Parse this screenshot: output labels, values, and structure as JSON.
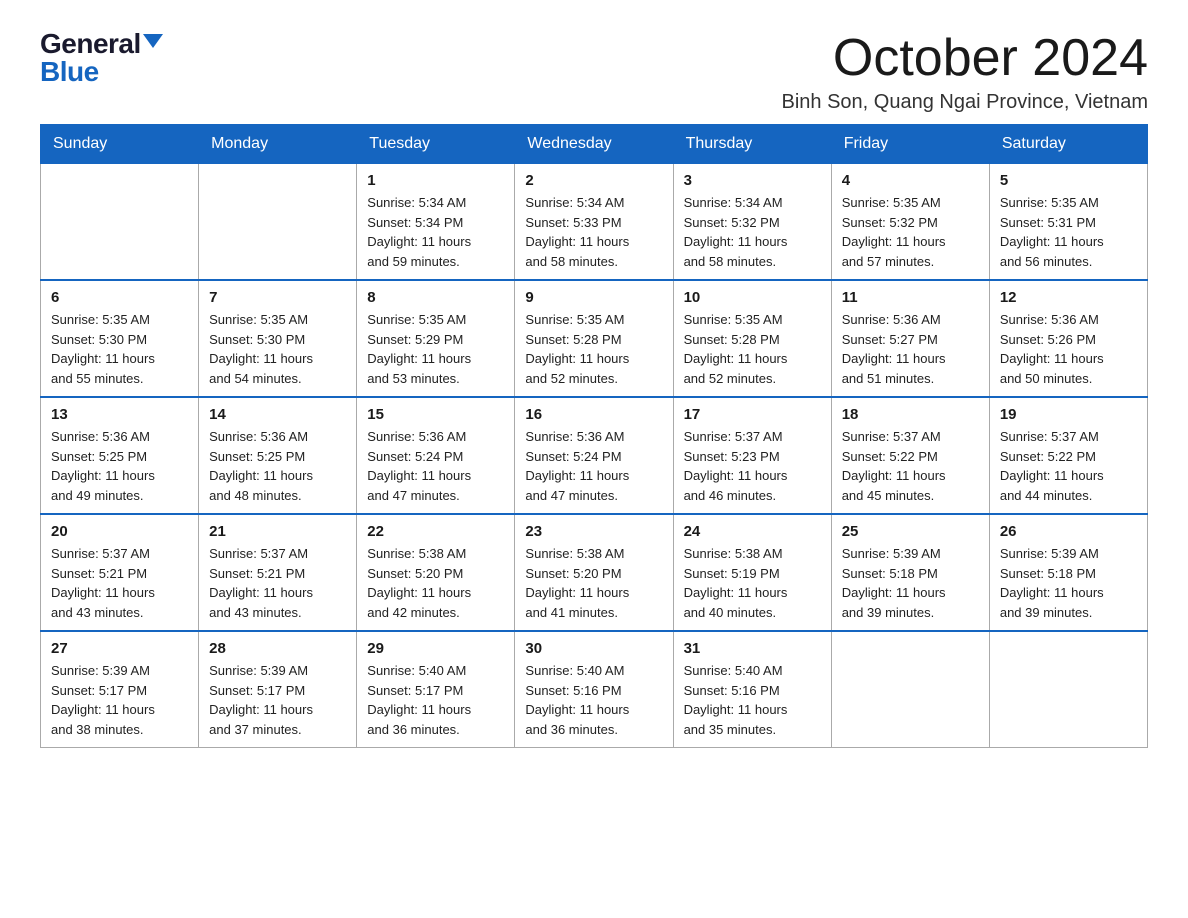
{
  "logo": {
    "general": "General",
    "blue": "Blue"
  },
  "header": {
    "month": "October 2024",
    "location": "Binh Son, Quang Ngai Province, Vietnam"
  },
  "weekdays": [
    "Sunday",
    "Monday",
    "Tuesday",
    "Wednesday",
    "Thursday",
    "Friday",
    "Saturday"
  ],
  "weeks": [
    [
      {
        "day": "",
        "info": ""
      },
      {
        "day": "",
        "info": ""
      },
      {
        "day": "1",
        "info": "Sunrise: 5:34 AM\nSunset: 5:34 PM\nDaylight: 11 hours\nand 59 minutes."
      },
      {
        "day": "2",
        "info": "Sunrise: 5:34 AM\nSunset: 5:33 PM\nDaylight: 11 hours\nand 58 minutes."
      },
      {
        "day": "3",
        "info": "Sunrise: 5:34 AM\nSunset: 5:32 PM\nDaylight: 11 hours\nand 58 minutes."
      },
      {
        "day": "4",
        "info": "Sunrise: 5:35 AM\nSunset: 5:32 PM\nDaylight: 11 hours\nand 57 minutes."
      },
      {
        "day": "5",
        "info": "Sunrise: 5:35 AM\nSunset: 5:31 PM\nDaylight: 11 hours\nand 56 minutes."
      }
    ],
    [
      {
        "day": "6",
        "info": "Sunrise: 5:35 AM\nSunset: 5:30 PM\nDaylight: 11 hours\nand 55 minutes."
      },
      {
        "day": "7",
        "info": "Sunrise: 5:35 AM\nSunset: 5:30 PM\nDaylight: 11 hours\nand 54 minutes."
      },
      {
        "day": "8",
        "info": "Sunrise: 5:35 AM\nSunset: 5:29 PM\nDaylight: 11 hours\nand 53 minutes."
      },
      {
        "day": "9",
        "info": "Sunrise: 5:35 AM\nSunset: 5:28 PM\nDaylight: 11 hours\nand 52 minutes."
      },
      {
        "day": "10",
        "info": "Sunrise: 5:35 AM\nSunset: 5:28 PM\nDaylight: 11 hours\nand 52 minutes."
      },
      {
        "day": "11",
        "info": "Sunrise: 5:36 AM\nSunset: 5:27 PM\nDaylight: 11 hours\nand 51 minutes."
      },
      {
        "day": "12",
        "info": "Sunrise: 5:36 AM\nSunset: 5:26 PM\nDaylight: 11 hours\nand 50 minutes."
      }
    ],
    [
      {
        "day": "13",
        "info": "Sunrise: 5:36 AM\nSunset: 5:25 PM\nDaylight: 11 hours\nand 49 minutes."
      },
      {
        "day": "14",
        "info": "Sunrise: 5:36 AM\nSunset: 5:25 PM\nDaylight: 11 hours\nand 48 minutes."
      },
      {
        "day": "15",
        "info": "Sunrise: 5:36 AM\nSunset: 5:24 PM\nDaylight: 11 hours\nand 47 minutes."
      },
      {
        "day": "16",
        "info": "Sunrise: 5:36 AM\nSunset: 5:24 PM\nDaylight: 11 hours\nand 47 minutes."
      },
      {
        "day": "17",
        "info": "Sunrise: 5:37 AM\nSunset: 5:23 PM\nDaylight: 11 hours\nand 46 minutes."
      },
      {
        "day": "18",
        "info": "Sunrise: 5:37 AM\nSunset: 5:22 PM\nDaylight: 11 hours\nand 45 minutes."
      },
      {
        "day": "19",
        "info": "Sunrise: 5:37 AM\nSunset: 5:22 PM\nDaylight: 11 hours\nand 44 minutes."
      }
    ],
    [
      {
        "day": "20",
        "info": "Sunrise: 5:37 AM\nSunset: 5:21 PM\nDaylight: 11 hours\nand 43 minutes."
      },
      {
        "day": "21",
        "info": "Sunrise: 5:37 AM\nSunset: 5:21 PM\nDaylight: 11 hours\nand 43 minutes."
      },
      {
        "day": "22",
        "info": "Sunrise: 5:38 AM\nSunset: 5:20 PM\nDaylight: 11 hours\nand 42 minutes."
      },
      {
        "day": "23",
        "info": "Sunrise: 5:38 AM\nSunset: 5:20 PM\nDaylight: 11 hours\nand 41 minutes."
      },
      {
        "day": "24",
        "info": "Sunrise: 5:38 AM\nSunset: 5:19 PM\nDaylight: 11 hours\nand 40 minutes."
      },
      {
        "day": "25",
        "info": "Sunrise: 5:39 AM\nSunset: 5:18 PM\nDaylight: 11 hours\nand 39 minutes."
      },
      {
        "day": "26",
        "info": "Sunrise: 5:39 AM\nSunset: 5:18 PM\nDaylight: 11 hours\nand 39 minutes."
      }
    ],
    [
      {
        "day": "27",
        "info": "Sunrise: 5:39 AM\nSunset: 5:17 PM\nDaylight: 11 hours\nand 38 minutes."
      },
      {
        "day": "28",
        "info": "Sunrise: 5:39 AM\nSunset: 5:17 PM\nDaylight: 11 hours\nand 37 minutes."
      },
      {
        "day": "29",
        "info": "Sunrise: 5:40 AM\nSunset: 5:17 PM\nDaylight: 11 hours\nand 36 minutes."
      },
      {
        "day": "30",
        "info": "Sunrise: 5:40 AM\nSunset: 5:16 PM\nDaylight: 11 hours\nand 36 minutes."
      },
      {
        "day": "31",
        "info": "Sunrise: 5:40 AM\nSunset: 5:16 PM\nDaylight: 11 hours\nand 35 minutes."
      },
      {
        "day": "",
        "info": ""
      },
      {
        "day": "",
        "info": ""
      }
    ]
  ]
}
